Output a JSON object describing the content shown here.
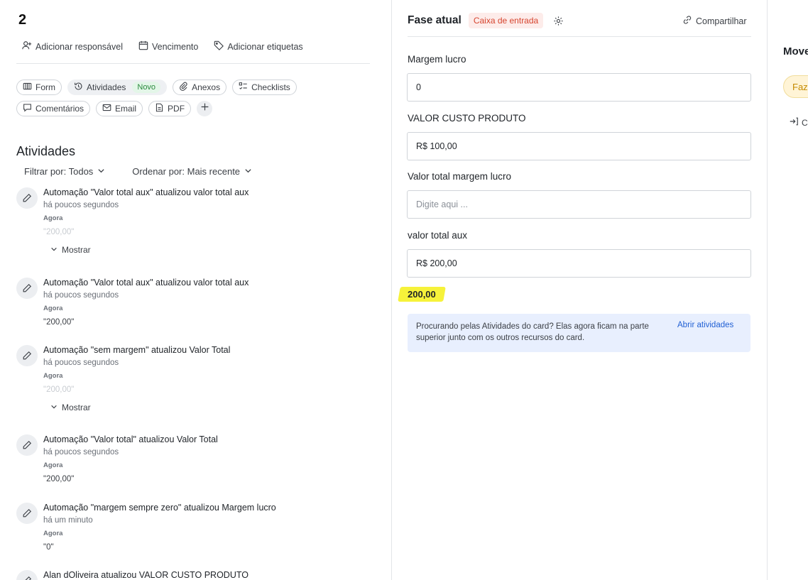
{
  "card": {
    "title": "2",
    "meta": {
      "assign_label": "Adicionar responsável",
      "due_label": "Vencimento",
      "tags_label": "Adicionar etiquetas"
    },
    "chips": {
      "form": "Form",
      "atividades": "Atividades",
      "novo_badge": "Novo",
      "anexos": "Anexos",
      "checklists": "Checklists",
      "comentarios": "Comentários",
      "email": "Email",
      "pdf": "PDF"
    }
  },
  "activities": {
    "title": "Atividades",
    "filter_label": "Filtrar por: Todos",
    "sort_label": "Ordenar por: Mais recente",
    "items": [
      {
        "text": "Automação \"Valor total aux\" atualizou valor total aux",
        "time": "há poucos segundos",
        "label": "Agora",
        "value": "\"200,00\"",
        "more": "Mostrar"
      },
      {
        "text": "Automação \"Valor total aux\" atualizou valor total aux",
        "time": "há poucos segundos",
        "label": "Agora",
        "value": "\"200,00\""
      },
      {
        "text": "Automação \"sem margem\" atualizou Valor Total",
        "time": "há poucos segundos",
        "label": "Agora",
        "value": "\"200,00\"",
        "more": "Mostrar"
      },
      {
        "text": "Automação \"Valor total\" atualizou Valor Total",
        "time": "há poucos segundos",
        "label": "Agora",
        "value": "\"200,00\""
      },
      {
        "text": "Automação \"margem sempre zero\" atualizou Margem lucro",
        "time": "há um minuto",
        "label": "Agora",
        "value": "\"0\""
      },
      {
        "text": "Alan dOliveira atualizou VALOR CUSTO PRODUTO"
      }
    ]
  },
  "phase": {
    "label": "Fase atual",
    "badge": "Caixa de entrada",
    "share_label": "Compartilhar"
  },
  "fields": {
    "margem_lucro": {
      "label": "Margem lucro",
      "value": "0"
    },
    "valor_custo": {
      "label": "VALOR CUSTO PRODUTO",
      "value": "R$ 100,00"
    },
    "valor_total_margem": {
      "label": "Valor total margem lucro",
      "value": "",
      "placeholder": "Digite aqui ..."
    },
    "valor_total_aux": {
      "label": "valor total aux",
      "value": "R$ 200,00"
    },
    "highlighted_value": "200,00"
  },
  "info": {
    "text": "Procurando pelas Atividades do card? Elas agora ficam na parte superior junto com os outros recursos do card.",
    "link": "Abrir atividades"
  },
  "move": {
    "title": "Move",
    "pill": "Faze",
    "action": "C"
  },
  "colors": {
    "phase_badge_bg": "#fdecea",
    "phase_badge_text": "#d6452f",
    "novo_badge_text": "#2b8a3e",
    "highlight": "#f6f23a",
    "info_bg": "#e8effe",
    "link": "#2160d4",
    "move_pill_text": "#c48a00"
  }
}
